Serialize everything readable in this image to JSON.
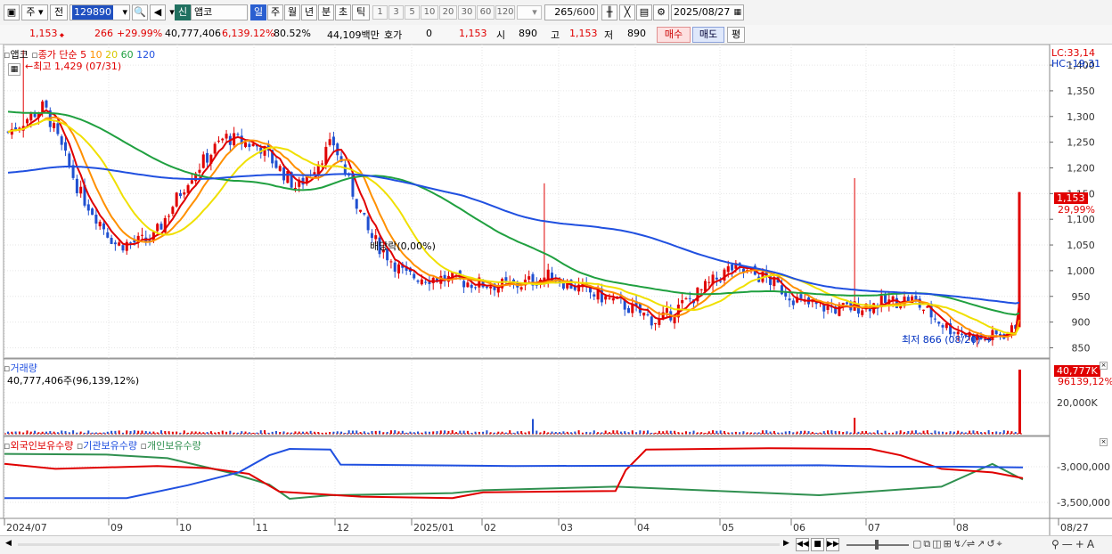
{
  "toolbar": {
    "mode1": "주",
    "mode2": "전",
    "code": "129890",
    "market_tag": "신",
    "stock_name": "앱코",
    "periods": [
      "일",
      "주",
      "월",
      "년",
      "분",
      "초",
      "틱"
    ],
    "minutes": [
      "1",
      "3",
      "5",
      "10",
      "20",
      "30",
      "60",
      "120"
    ],
    "count": "265",
    "count_total": "/600",
    "date": "2025/08/27"
  },
  "quote": {
    "price": "1,153",
    "change": "266",
    "change_pct": "+29.99%",
    "volume": "40,777,406",
    "volume_pct": "6,139.12%",
    "turnover": "80.52%",
    "amount": "44,109백만",
    "hoga_label": "호가",
    "hoga_value": "0",
    "hoga_price": "1,153",
    "open_label": "시",
    "open": "890",
    "high_label": "고",
    "high": "1,153",
    "low_label": "저",
    "low": "890",
    "buy": "매수",
    "sell": "매도",
    "avg": "평"
  },
  "price_pane": {
    "name": "앱코",
    "legend_title": "종가 단순",
    "ma": [
      {
        "label": "5",
        "color": "#e00000"
      },
      {
        "label": "10",
        "color": "#ff9000"
      },
      {
        "label": "20",
        "color": "#e8e000"
      },
      {
        "label": "60",
        "color": "#20a040"
      },
      {
        "label": "120",
        "color": "#2050e0"
      }
    ],
    "high_note": "최고 1,429 (07/31)",
    "low_note": "최저 866 (08/20)",
    "dividend_note": "배당락(0,00%)",
    "lc": "LC:33,14",
    "hc": "HC:-19,31",
    "current_tag": "1,153",
    "current_pct": "29,99%",
    "y_ticks": [
      "1,400",
      "1,350",
      "1,300",
      "1,250",
      "1,200",
      "1,150",
      "1,100",
      "1,050",
      "1,000",
      "950",
      "900",
      "850"
    ]
  },
  "volume_pane": {
    "title": "거래량",
    "value": "40,777,406주(96,139,12%)",
    "tag": "40,777K",
    "tag_pct": "96139,12%",
    "y_tick": "20,000K"
  },
  "holding_pane": {
    "series": [
      {
        "label": "외국인보유수량",
        "color": "#e00000"
      },
      {
        "label": "기관보유수량",
        "color": "#2050e0"
      },
      {
        "label": "개인보유수량",
        "color": "#309050"
      }
    ],
    "y_ticks": [
      "-3,000,000",
      "-3,500,000"
    ]
  },
  "x_axis": [
    "2024/07",
    "09",
    "10",
    "11",
    "12",
    "2025/01",
    "02",
    "03",
    "04",
    "05",
    "06",
    "07",
    "08",
    "08/27"
  ],
  "chart_data": {
    "type": "candlestick",
    "period": "daily",
    "title": "앱코",
    "ylim": [
      830,
      1440
    ],
    "close_path": [
      [
        "2024/07",
        1270
      ],
      [
        "2024/07-end",
        1320
      ],
      [
        "2024/08",
        1150
      ],
      [
        "2024/08-mid",
        1050
      ],
      [
        "2024/09",
        1060
      ],
      [
        "2024/09-mid",
        1180
      ],
      [
        "2024/10",
        1260
      ],
      [
        "2024/10-mid",
        1240
      ],
      [
        "2024/11",
        1160
      ],
      [
        "2024/11-mid",
        1250
      ],
      [
        "2024/12",
        1070
      ],
      [
        "2024/12-mid",
        990
      ],
      [
        "2025/01",
        985
      ],
      [
        "2025/01-mid",
        975
      ],
      [
        "2025/02",
        970
      ],
      [
        "2025/02-mid",
        990
      ],
      [
        "2025/03",
        960
      ],
      [
        "2025/03-mid",
        935
      ],
      [
        "2025/04",
        900
      ],
      [
        "2025/04-mid",
        950
      ],
      [
        "2025/05",
        1005
      ],
      [
        "2025/05-mid",
        985
      ],
      [
        "2025/06",
        935
      ],
      [
        "2025/06-mid",
        925
      ],
      [
        "2025/07",
        935
      ],
      [
        "2025/07-mid",
        945
      ],
      [
        "2025/08",
        890
      ],
      [
        "2025/08-20",
        866
      ],
      [
        "2025/08-26",
        887
      ],
      [
        "2025/08-27",
        1153
      ]
    ],
    "last": {
      "open": 890,
      "high": 1153,
      "low": 890,
      "close": 1153,
      "change": 266,
      "change_pct": 29.99
    },
    "highest": {
      "value": 1429,
      "date": "07/31"
    },
    "lowest": {
      "value": 866,
      "date": "08/20"
    },
    "volume_last": 40777406,
    "holdings_ylim": [
      -3700000,
      -2600000
    ]
  }
}
